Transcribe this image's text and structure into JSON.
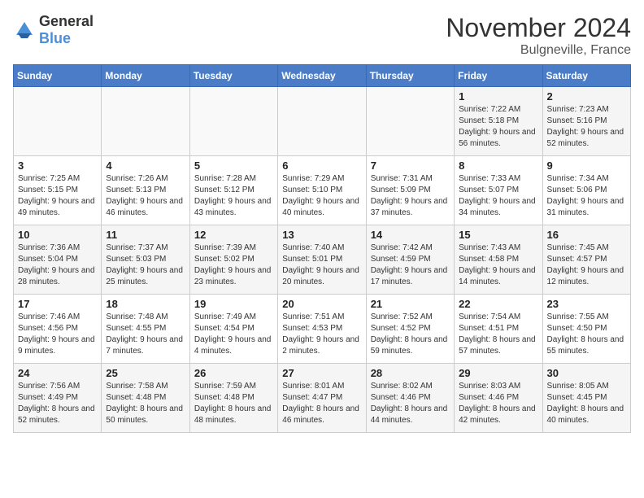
{
  "logo": {
    "text_general": "General",
    "text_blue": "Blue"
  },
  "title": {
    "month": "November 2024",
    "location": "Bulgneville, France"
  },
  "weekdays": [
    "Sunday",
    "Monday",
    "Tuesday",
    "Wednesday",
    "Thursday",
    "Friday",
    "Saturday"
  ],
  "weeks": [
    [
      {
        "day": "",
        "info": ""
      },
      {
        "day": "",
        "info": ""
      },
      {
        "day": "",
        "info": ""
      },
      {
        "day": "",
        "info": ""
      },
      {
        "day": "",
        "info": ""
      },
      {
        "day": "1",
        "info": "Sunrise: 7:22 AM\nSunset: 5:18 PM\nDaylight: 9 hours and 56 minutes."
      },
      {
        "day": "2",
        "info": "Sunrise: 7:23 AM\nSunset: 5:16 PM\nDaylight: 9 hours and 52 minutes."
      }
    ],
    [
      {
        "day": "3",
        "info": "Sunrise: 7:25 AM\nSunset: 5:15 PM\nDaylight: 9 hours and 49 minutes."
      },
      {
        "day": "4",
        "info": "Sunrise: 7:26 AM\nSunset: 5:13 PM\nDaylight: 9 hours and 46 minutes."
      },
      {
        "day": "5",
        "info": "Sunrise: 7:28 AM\nSunset: 5:12 PM\nDaylight: 9 hours and 43 minutes."
      },
      {
        "day": "6",
        "info": "Sunrise: 7:29 AM\nSunset: 5:10 PM\nDaylight: 9 hours and 40 minutes."
      },
      {
        "day": "7",
        "info": "Sunrise: 7:31 AM\nSunset: 5:09 PM\nDaylight: 9 hours and 37 minutes."
      },
      {
        "day": "8",
        "info": "Sunrise: 7:33 AM\nSunset: 5:07 PM\nDaylight: 9 hours and 34 minutes."
      },
      {
        "day": "9",
        "info": "Sunrise: 7:34 AM\nSunset: 5:06 PM\nDaylight: 9 hours and 31 minutes."
      }
    ],
    [
      {
        "day": "10",
        "info": "Sunrise: 7:36 AM\nSunset: 5:04 PM\nDaylight: 9 hours and 28 minutes."
      },
      {
        "day": "11",
        "info": "Sunrise: 7:37 AM\nSunset: 5:03 PM\nDaylight: 9 hours and 25 minutes."
      },
      {
        "day": "12",
        "info": "Sunrise: 7:39 AM\nSunset: 5:02 PM\nDaylight: 9 hours and 23 minutes."
      },
      {
        "day": "13",
        "info": "Sunrise: 7:40 AM\nSunset: 5:01 PM\nDaylight: 9 hours and 20 minutes."
      },
      {
        "day": "14",
        "info": "Sunrise: 7:42 AM\nSunset: 4:59 PM\nDaylight: 9 hours and 17 minutes."
      },
      {
        "day": "15",
        "info": "Sunrise: 7:43 AM\nSunset: 4:58 PM\nDaylight: 9 hours and 14 minutes."
      },
      {
        "day": "16",
        "info": "Sunrise: 7:45 AM\nSunset: 4:57 PM\nDaylight: 9 hours and 12 minutes."
      }
    ],
    [
      {
        "day": "17",
        "info": "Sunrise: 7:46 AM\nSunset: 4:56 PM\nDaylight: 9 hours and 9 minutes."
      },
      {
        "day": "18",
        "info": "Sunrise: 7:48 AM\nSunset: 4:55 PM\nDaylight: 9 hours and 7 minutes."
      },
      {
        "day": "19",
        "info": "Sunrise: 7:49 AM\nSunset: 4:54 PM\nDaylight: 9 hours and 4 minutes."
      },
      {
        "day": "20",
        "info": "Sunrise: 7:51 AM\nSunset: 4:53 PM\nDaylight: 9 hours and 2 minutes."
      },
      {
        "day": "21",
        "info": "Sunrise: 7:52 AM\nSunset: 4:52 PM\nDaylight: 8 hours and 59 minutes."
      },
      {
        "day": "22",
        "info": "Sunrise: 7:54 AM\nSunset: 4:51 PM\nDaylight: 8 hours and 57 minutes."
      },
      {
        "day": "23",
        "info": "Sunrise: 7:55 AM\nSunset: 4:50 PM\nDaylight: 8 hours and 55 minutes."
      }
    ],
    [
      {
        "day": "24",
        "info": "Sunrise: 7:56 AM\nSunset: 4:49 PM\nDaylight: 8 hours and 52 minutes."
      },
      {
        "day": "25",
        "info": "Sunrise: 7:58 AM\nSunset: 4:48 PM\nDaylight: 8 hours and 50 minutes."
      },
      {
        "day": "26",
        "info": "Sunrise: 7:59 AM\nSunset: 4:48 PM\nDaylight: 8 hours and 48 minutes."
      },
      {
        "day": "27",
        "info": "Sunrise: 8:01 AM\nSunset: 4:47 PM\nDaylight: 8 hours and 46 minutes."
      },
      {
        "day": "28",
        "info": "Sunrise: 8:02 AM\nSunset: 4:46 PM\nDaylight: 8 hours and 44 minutes."
      },
      {
        "day": "29",
        "info": "Sunrise: 8:03 AM\nSunset: 4:46 PM\nDaylight: 8 hours and 42 minutes."
      },
      {
        "day": "30",
        "info": "Sunrise: 8:05 AM\nSunset: 4:45 PM\nDaylight: 8 hours and 40 minutes."
      }
    ]
  ]
}
